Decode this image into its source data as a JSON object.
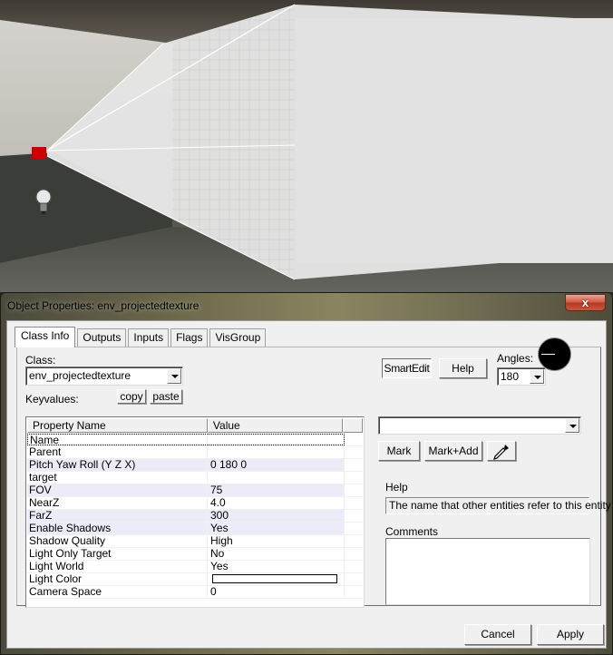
{
  "viewport": {
    "description": "3D editor view with projected texture frustum",
    "entity_marker_color": "#cc0000",
    "frustum_color": "#e6e6e6"
  },
  "dialog": {
    "title": "Object Properties: env_projectedtexture",
    "close_label": "x",
    "tabs": [
      {
        "label": "Class Info",
        "active": true
      },
      {
        "label": "Outputs",
        "active": false
      },
      {
        "label": "Inputs",
        "active": false
      },
      {
        "label": "Flags",
        "active": false
      },
      {
        "label": "VisGroup",
        "active": false
      }
    ],
    "class_label": "Class:",
    "class_value": "env_projectedtexture",
    "keyvalues_label": "Keyvalues:",
    "copy_label": "copy",
    "paste_label": "paste",
    "smartedit_label": "SmartEdit",
    "help_button_label": "Help",
    "angles_label": "Angles:",
    "angles_value": "180",
    "grid": {
      "headers": [
        "Property Name",
        "Value"
      ],
      "rows": [
        {
          "name": "Name",
          "value": ""
        },
        {
          "name": "Parent",
          "value": ""
        },
        {
          "name": "Pitch Yaw Roll (Y Z X)",
          "value": "0 180 0"
        },
        {
          "name": "target",
          "value": ""
        },
        {
          "name": "FOV",
          "value": "75"
        },
        {
          "name": "NearZ",
          "value": "4.0"
        },
        {
          "name": "FarZ",
          "value": "300"
        },
        {
          "name": "Enable Shadows",
          "value": "Yes"
        },
        {
          "name": "Shadow Quality",
          "value": "High"
        },
        {
          "name": "Light Only Target",
          "value": "No"
        },
        {
          "name": "Light World",
          "value": "Yes"
        },
        {
          "name": "Light Color",
          "value": "",
          "color_swatch": "#ffffff"
        },
        {
          "name": "Camera Space",
          "value": "0"
        }
      ]
    },
    "value_combo": "",
    "mark_label": "Mark",
    "mark_add_label": "Mark+Add",
    "eyedropper_icon": "eyedropper-icon",
    "help_label": "Help",
    "help_text": "The name that other entities refer to this entity",
    "comments_label": "Comments",
    "comments_value": "",
    "cancel_label": "Cancel",
    "apply_label": "Apply"
  }
}
